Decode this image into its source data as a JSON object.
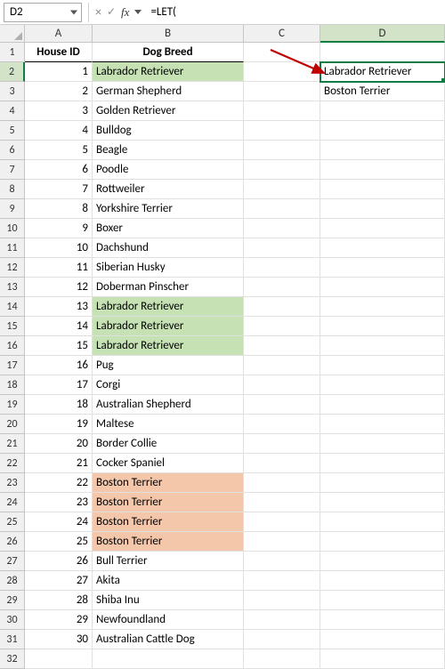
{
  "formula_bar": {
    "cell_ref": "D2",
    "cancel_icon": "×",
    "confirm_icon": "✓",
    "fx_label": "fx",
    "formula": "=LET("
  },
  "columns": [
    "A",
    "B",
    "C",
    "D"
  ],
  "headers": {
    "col_a": "House ID",
    "col_b": "Dog Breed"
  },
  "table": [
    {
      "id": "1",
      "breed": "Labrador Retriever",
      "hl": "g"
    },
    {
      "id": "2",
      "breed": "German Shepherd",
      "hl": ""
    },
    {
      "id": "3",
      "breed": "Golden Retriever",
      "hl": ""
    },
    {
      "id": "4",
      "breed": "Bulldog",
      "hl": ""
    },
    {
      "id": "5",
      "breed": "Beagle",
      "hl": ""
    },
    {
      "id": "6",
      "breed": "Poodle",
      "hl": ""
    },
    {
      "id": "7",
      "breed": "Rottweiler",
      "hl": ""
    },
    {
      "id": "8",
      "breed": "Yorkshire Terrier",
      "hl": ""
    },
    {
      "id": "9",
      "breed": "Boxer",
      "hl": ""
    },
    {
      "id": "10",
      "breed": "Dachshund",
      "hl": ""
    },
    {
      "id": "11",
      "breed": "Siberian Husky",
      "hl": ""
    },
    {
      "id": "12",
      "breed": "Doberman Pinscher",
      "hl": ""
    },
    {
      "id": "13",
      "breed": "Labrador Retriever",
      "hl": "g"
    },
    {
      "id": "14",
      "breed": "Labrador Retriever",
      "hl": "g"
    },
    {
      "id": "15",
      "breed": "Labrador Retriever",
      "hl": "g"
    },
    {
      "id": "16",
      "breed": "Pug",
      "hl": ""
    },
    {
      "id": "17",
      "breed": "Corgi",
      "hl": ""
    },
    {
      "id": "18",
      "breed": "Australian Shepherd",
      "hl": ""
    },
    {
      "id": "19",
      "breed": "Maltese",
      "hl": ""
    },
    {
      "id": "20",
      "breed": "Border Collie",
      "hl": ""
    },
    {
      "id": "21",
      "breed": "Cocker Spaniel",
      "hl": ""
    },
    {
      "id": "22",
      "breed": "Boston Terrier",
      "hl": "o"
    },
    {
      "id": "23",
      "breed": "Boston Terrier",
      "hl": "o"
    },
    {
      "id": "24",
      "breed": "Boston Terrier",
      "hl": "o"
    },
    {
      "id": "25",
      "breed": "Boston Terrier",
      "hl": "o"
    },
    {
      "id": "26",
      "breed": "Bull Terrier",
      "hl": ""
    },
    {
      "id": "27",
      "breed": "Akita",
      "hl": ""
    },
    {
      "id": "28",
      "breed": "Shiba Inu",
      "hl": ""
    },
    {
      "id": "29",
      "breed": "Newfoundland",
      "hl": ""
    },
    {
      "id": "30",
      "breed": "Australian Cattle Dog",
      "hl": ""
    }
  ],
  "results": {
    "d2": "Labrador Retriever",
    "d3": "Boston Terrier"
  },
  "extra_row": "32",
  "arrow_color": "#c00000"
}
